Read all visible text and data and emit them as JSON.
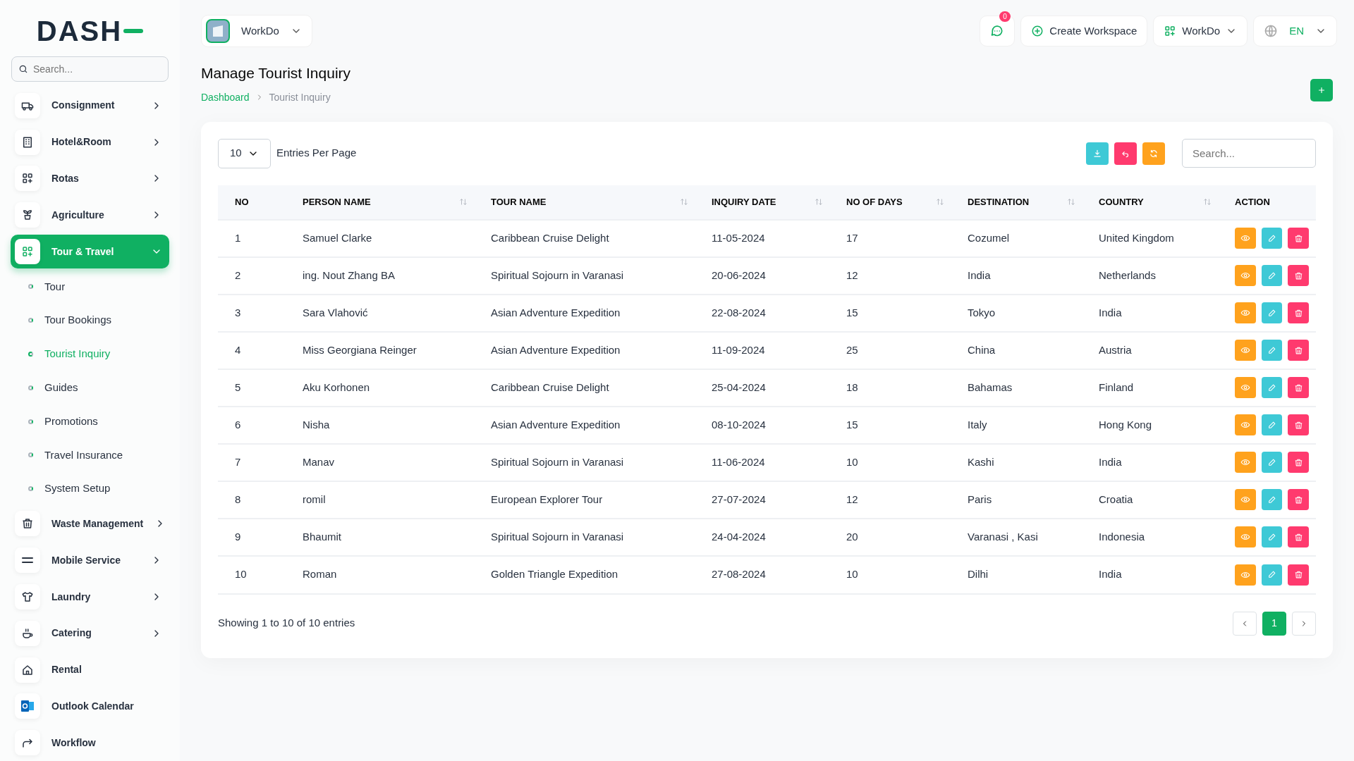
{
  "logo": "DASH",
  "sidebar": {
    "search_placeholder": "Search...",
    "items": [
      {
        "label": "Consignment",
        "has_submenu": true,
        "expanded": false
      },
      {
        "label": "Hotel&Room",
        "has_submenu": true,
        "expanded": false
      },
      {
        "label": "Rotas",
        "has_submenu": true,
        "expanded": false
      },
      {
        "label": "Agriculture",
        "has_submenu": true,
        "expanded": false
      },
      {
        "label": "Tour & Travel",
        "has_submenu": true,
        "expanded": true,
        "children": [
          {
            "label": "Tour",
            "selected": false
          },
          {
            "label": "Tour Bookings",
            "selected": false
          },
          {
            "label": "Tourist Inquiry",
            "selected": true
          },
          {
            "label": "Guides",
            "selected": false
          },
          {
            "label": "Promotions",
            "selected": false
          },
          {
            "label": "Travel Insurance",
            "selected": false
          },
          {
            "label": "System Setup",
            "selected": false
          }
        ]
      },
      {
        "label": "Waste Management",
        "has_submenu": true,
        "expanded": false
      },
      {
        "label": "Mobile Service",
        "has_submenu": true,
        "expanded": false
      },
      {
        "label": "Laundry",
        "has_submenu": true,
        "expanded": false
      },
      {
        "label": "Catering",
        "has_submenu": true,
        "expanded": false
      },
      {
        "label": "Rental",
        "has_submenu": false,
        "expanded": false
      },
      {
        "label": "Outlook Calendar",
        "has_submenu": false,
        "expanded": false
      },
      {
        "label": "Workflow",
        "has_submenu": false,
        "expanded": false
      }
    ]
  },
  "header": {
    "workspace": "WorkDo",
    "notification_count": "0",
    "create_workspace": "Create Workspace",
    "workspace_menu": "WorkDo",
    "language": "EN"
  },
  "page": {
    "title": "Manage Tourist Inquiry",
    "breadcrumb": [
      {
        "label": "Dashboard"
      },
      {
        "label": "Tourist Inquiry"
      }
    ]
  },
  "table": {
    "entries_value": "10",
    "entries_label": "Entries Per Page",
    "search_placeholder": "Search...",
    "columns": [
      {
        "label": "NO",
        "sortable": false
      },
      {
        "label": "PERSON NAME",
        "sortable": true
      },
      {
        "label": "TOUR NAME",
        "sortable": true
      },
      {
        "label": "INQUIRY DATE",
        "sortable": true
      },
      {
        "label": "NO OF DAYS",
        "sortable": true
      },
      {
        "label": "DESTINATION",
        "sortable": true
      },
      {
        "label": "COUNTRY",
        "sortable": true
      },
      {
        "label": "ACTION",
        "sortable": false
      }
    ],
    "rows": [
      [
        "1",
        "Samuel Clarke",
        "Caribbean Cruise Delight",
        "11-05-2024",
        "17",
        "Cozumel",
        "United Kingdom"
      ],
      [
        "2",
        "ing. Nout Zhang BA",
        "Spiritual Sojourn in Varanasi",
        "20-06-2024",
        "12",
        "India",
        "Netherlands"
      ],
      [
        "3",
        "Sara Vlahović",
        "Asian Adventure Expedition",
        "22-08-2024",
        "15",
        "Tokyo",
        "India"
      ],
      [
        "4",
        "Miss Georgiana Reinger",
        "Asian Adventure Expedition",
        "11-09-2024",
        "25",
        "China",
        "Austria"
      ],
      [
        "5",
        "Aku Korhonen",
        "Caribbean Cruise Delight",
        "25-04-2024",
        "18",
        "Bahamas",
        "Finland"
      ],
      [
        "6",
        "Nisha",
        "Asian Adventure Expedition",
        "08-10-2024",
        "15",
        "Italy",
        "Hong Kong"
      ],
      [
        "7",
        "Manav",
        "Spiritual Sojourn in Varanasi",
        "11-06-2024",
        "10",
        "Kashi",
        "India"
      ],
      [
        "8",
        "romil",
        "European Explorer Tour",
        "27-07-2024",
        "12",
        "Paris",
        "Croatia"
      ],
      [
        "9",
        "Bhaumit",
        "Spiritual Sojourn in Varanasi",
        "24-04-2024",
        "20",
        "Varanasi , Kasi",
        "Indonesia"
      ],
      [
        "10",
        "Roman",
        "Golden Triangle Expedition",
        "27-08-2024",
        "10",
        "Dilhi",
        "India"
      ]
    ],
    "summary": "Showing 1 to 10 of 10 entries",
    "pages": [
      {
        "label": "1",
        "selected": true
      }
    ]
  }
}
